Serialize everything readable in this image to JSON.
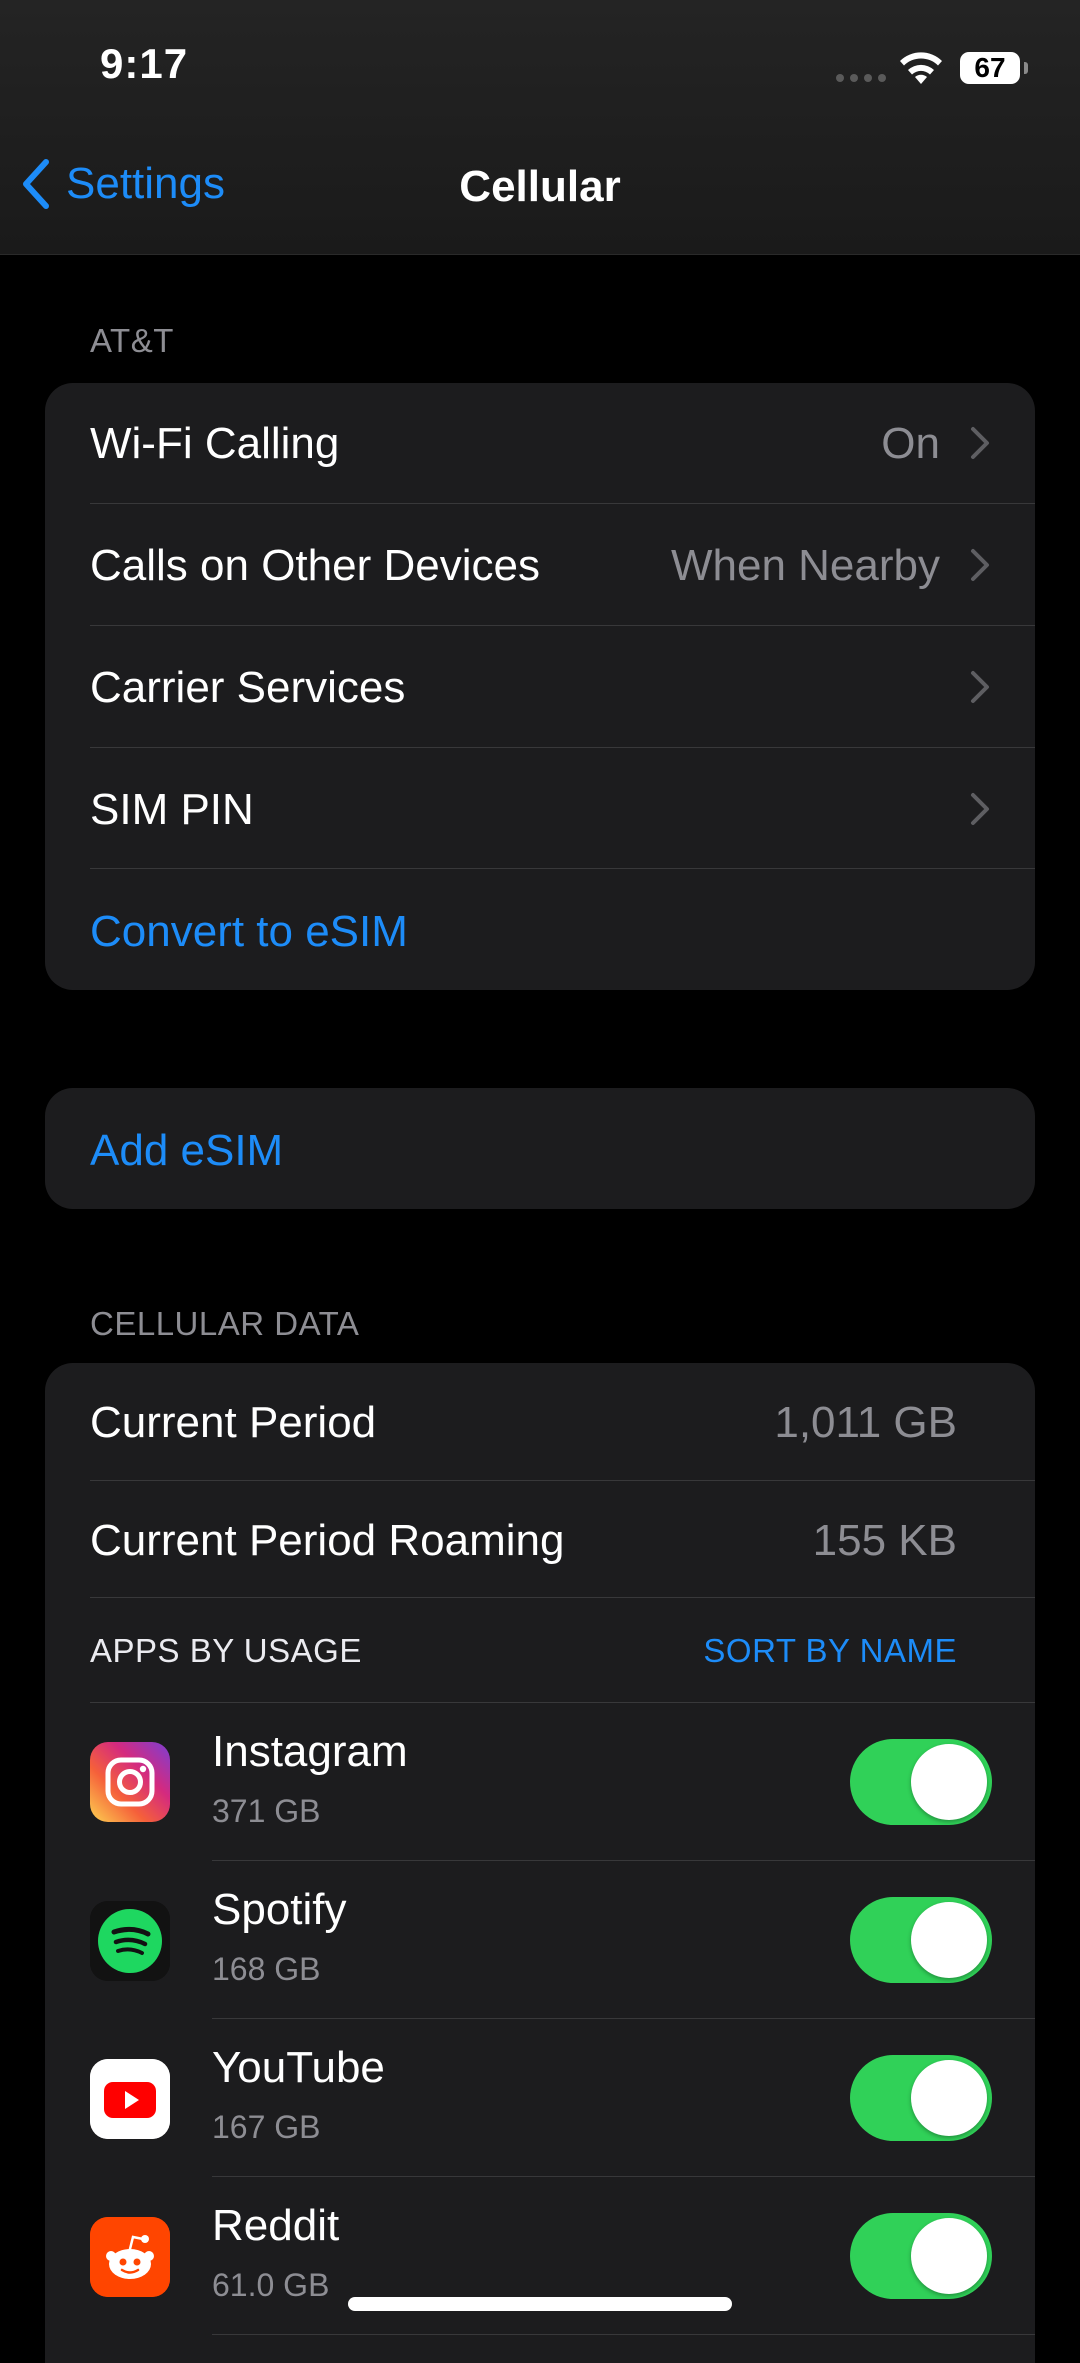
{
  "status_bar": {
    "time": "9:17",
    "battery": "67"
  },
  "nav": {
    "back_label": "Settings",
    "title": "Cellular"
  },
  "carrier_section": {
    "header": "AT&T",
    "rows": [
      {
        "label": "Wi-Fi Calling",
        "value": "On"
      },
      {
        "label": "Calls on Other Devices",
        "value": "When Nearby"
      },
      {
        "label": "Carrier Services",
        "value": ""
      },
      {
        "label": "SIM PIN",
        "value": ""
      },
      {
        "label": "Convert to eSIM",
        "value": ""
      }
    ]
  },
  "add_esim": {
    "label": "Add eSIM"
  },
  "cellular_data": {
    "header": "CELLULAR DATA",
    "current_period": {
      "label": "Current Period",
      "value": "1,011 GB"
    },
    "current_period_roaming": {
      "label": "Current Period Roaming",
      "value": "155 KB"
    },
    "apps_by_usage_label": "APPS BY USAGE",
    "sort_label": "SORT BY NAME",
    "apps": [
      {
        "name": "Instagram",
        "size": "371 GB",
        "enabled": true,
        "icon": "instagram-icon"
      },
      {
        "name": "Spotify",
        "size": "168 GB",
        "enabled": true,
        "icon": "spotify-icon"
      },
      {
        "name": "YouTube",
        "size": "167 GB",
        "enabled": true,
        "icon": "youtube-icon"
      },
      {
        "name": "Reddit",
        "size": "61.0 GB",
        "enabled": true,
        "icon": "reddit-icon"
      }
    ]
  },
  "colors": {
    "background": "#000000",
    "group_background": "#1c1c1e",
    "accent_blue": "#1d8cf8",
    "toggle_on": "#30d158",
    "secondary_text": "#8d8d93"
  }
}
